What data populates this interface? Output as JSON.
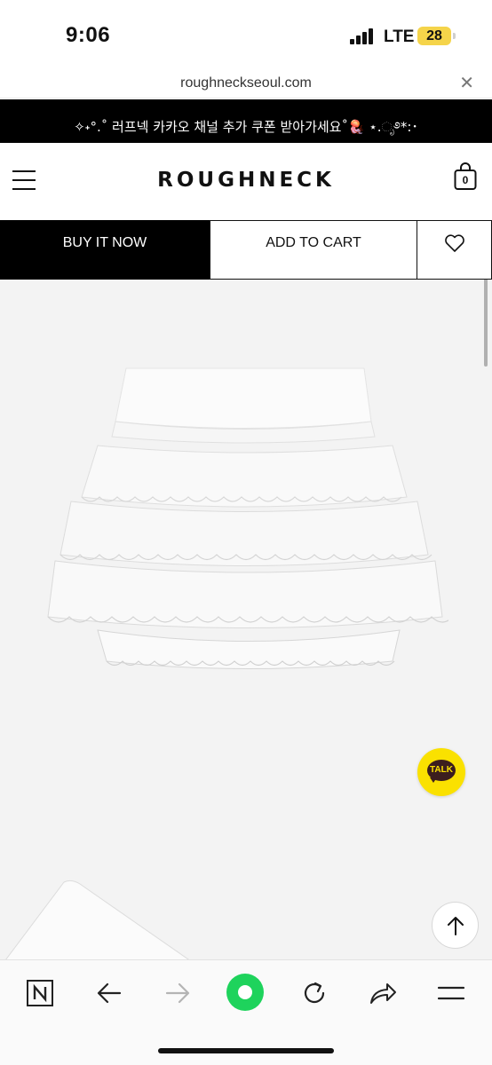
{
  "status_bar": {
    "time": "9:06",
    "network": "LTE",
    "battery": "28",
    "battery_color": "#f5d44a"
  },
  "browser": {
    "url": "roughneckseoul.com",
    "close_icon": "close-icon"
  },
  "announcement": {
    "text": "✧˖°.˚ 러프넥 카카오 채널 추가 쿠폰 받아가세요˚🪼 ⋆.ೃ࿔*:･"
  },
  "header": {
    "logo": "ROUGHNECK",
    "cart_count": "0",
    "menu_icon": "hamburger-menu-icon",
    "cart_icon": "shopping-bag-icon"
  },
  "actions": {
    "buy_now": "BUY IT NOW",
    "add_to_cart": "ADD TO CART",
    "wishlist_icon": "heart-icon"
  },
  "floating": {
    "kakao_label": "TALK",
    "kakao_color": "#fae100",
    "top_icon": "arrow-up-icon"
  },
  "toolbar": {
    "items": [
      "naver-icon",
      "back-arrow-icon",
      "forward-arrow-icon",
      "green-dot-icon",
      "refresh-icon",
      "share-icon",
      "menu-icon"
    ],
    "accent": "#1ed35c"
  }
}
